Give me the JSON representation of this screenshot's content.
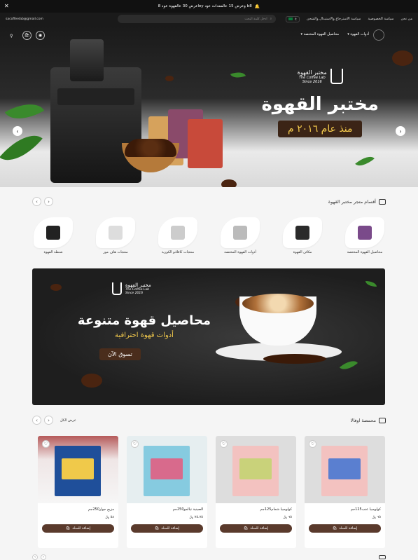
{
  "announcement": {
    "text": "عرض 30 عالقهوة عود 8ley وعرض 15 عالمعدات عود b8",
    "close_icon": "close-icon",
    "bell_icon": "bell-icon"
  },
  "header": {
    "nav": [
      "من نحن",
      "سياسة الخصوصية",
      "سياسة الاسترجاع والاستبدال والشحن"
    ],
    "search_placeholder": "ادخل كلمة البحث",
    "lang": "ع",
    "email": "sacoffeelab@gmail.com"
  },
  "hero": {
    "nav": [
      "أدوات القهوة",
      "محاصيل القهوة المختصة"
    ],
    "brand_name": "مختبر القهوة",
    "brand_sub": "The Coffee Lab",
    "brand_since_small": "Since 2016",
    "title": "مختبر القهوة",
    "since": "منذ عام ٢٠١٦ م",
    "colors": {
      "accent": "#3b2416",
      "gold": "#f2c94c"
    }
  },
  "categories": {
    "title": "أقسام متجر مختبر القهوة",
    "items": [
      {
        "label": "محاصيل القهوة المختصة",
        "color": "#7a4a8a"
      },
      {
        "label": "مكائن القهوة",
        "color": "#2a2a2a"
      },
      {
        "label": "أدوات القهوة المختصة",
        "color": "#bbbbbb"
      },
      {
        "label": "منتجات كافلانو الكورية",
        "color": "#cccccc"
      },
      {
        "label": "منتجات هاف مور",
        "color": "#dddddd"
      },
      {
        "label": "شنطة القهوة",
        "color": "#222222"
      }
    ]
  },
  "banner": {
    "brand_name": "مختبر القهوة",
    "brand_sub": "The Coffee Lab",
    "brand_since_small": "Since 2016",
    "headline": "محاصيل قهوة متنوعة",
    "subline": "أدوات قهوة احترافية",
    "cta": "تسوق الآن"
  },
  "products_section": {
    "title": "محمصة اوفالا",
    "view_all": "عرض الكل",
    "add_label": "إضافة للسلة",
    "items": [
      {
        "name": "كولومبيا عنب125جم",
        "price": "٦٥ ﷼",
        "color": "#f3c2c0",
        "win": "#5a7fd0"
      },
      {
        "name": "كولومبيا شمام125جم",
        "price": "٦٥ ﷼",
        "color": "#f3c2c0",
        "win": "#c9d27a"
      },
      {
        "name": "الصينية تيالمو250جم",
        "price": "٧٥.٧٥ ﷼",
        "color": "#86cbe0",
        "win": "#d86a8c"
      },
      {
        "name": "مزيج جوار250جم",
        "price": "٥٨ ﷼",
        "color": "#1f4f9a",
        "win": "#f0c94a"
      }
    ]
  }
}
